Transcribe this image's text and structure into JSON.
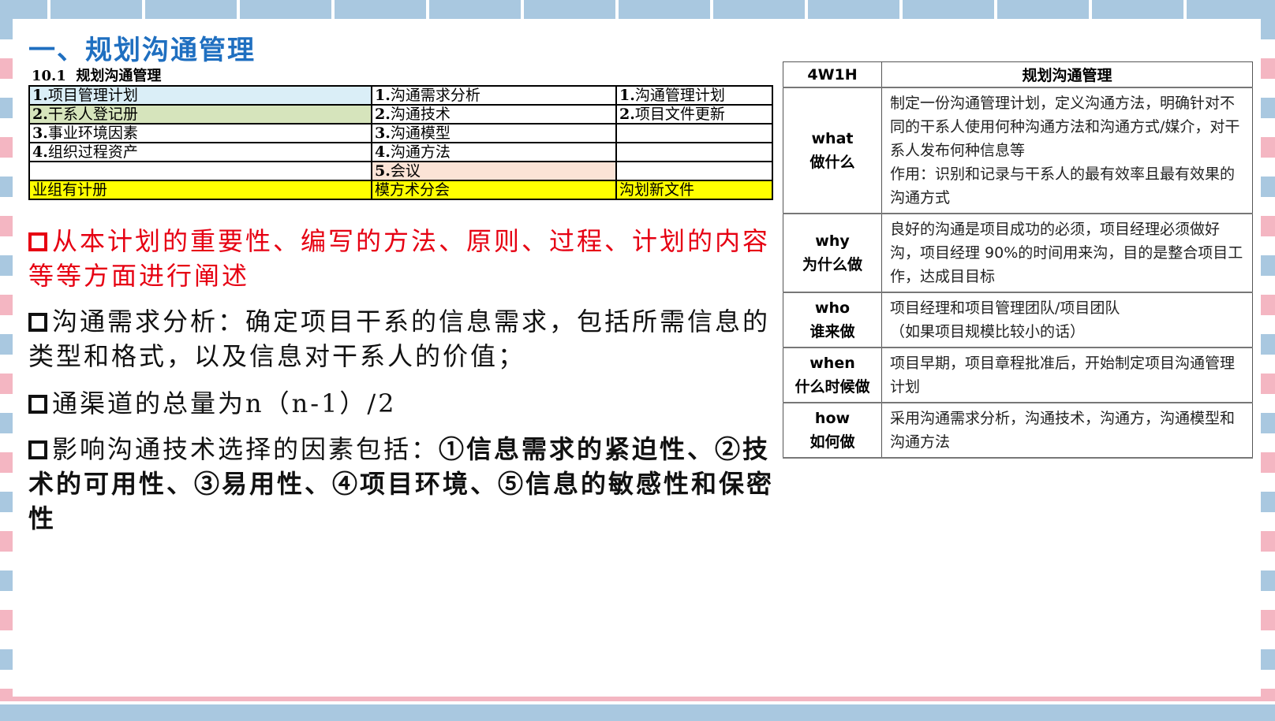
{
  "title": "一、规划沟通管理",
  "itto": {
    "caption_num": "10.1",
    "caption": "规划沟通管理",
    "rows": [
      [
        "1.",
        "项目管理计划",
        "1.",
        "沟通需求分析",
        "1.",
        "沟通管理计划"
      ],
      [
        "2.",
        "干系人登记册",
        "2.",
        "沟通技术",
        "2.",
        "项目文件更新"
      ],
      [
        "3.",
        "事业环境因素",
        "3.",
        "沟通模型",
        "",
        ""
      ],
      [
        "4.",
        "组织过程资产",
        "4.",
        "沟通方法",
        "",
        ""
      ],
      [
        "",
        "",
        "5.",
        "会议",
        "",
        ""
      ],
      [
        "",
        "业组有计册",
        "",
        "模方术分会",
        "",
        "沟划新文件"
      ]
    ],
    "colors": {
      "input1": "#daeef7",
      "input2": "#d6e4bc",
      "meeting": "#fbe3d6",
      "summary": "#ffff00"
    }
  },
  "bullets": {
    "b1": "从本计划的重要性、编写的方法、原则、过程、计划的内容等等方面进行阐述",
    "b2": "沟通需求分析：确定项目干系的信息需求，包括所需信息的类型和格式，以及信息对干系人的价值；",
    "b3": "通渠道的总量为n（n-1）/2",
    "b4_lead": "影响沟通技术选择的因素包括：",
    "b4_rest": "①信息需求的紧迫性、②技术的可用性、③易用性、④项目环境、⑤信息的敏感性和保密性"
  },
  "w4h": {
    "header_left": "4W1H",
    "header_right": "规划沟通管理",
    "rows": [
      {
        "en": "what",
        "zh": "做什么",
        "text1": "制定一份沟通管理计划，定义沟通方法，明确针对不同的干系人使用何种沟通方法和沟通方式/媒介，对干系人发布何种信息等",
        "text2": "作用：识别和记录与干系人的最有效率且最有效果的沟通方式"
      },
      {
        "en": "why",
        "zh": "为什么做",
        "text1": "良好的沟通是项目成功的必须，项目经理必须做好沟，项目经理 90%的时间用来沟，目的是整合项目工作，达成目目标",
        "text2": ""
      },
      {
        "en": "who",
        "zh": "谁来做",
        "text1": "项目经理和项目管理团队/项目团队",
        "text2": "（如果项目规模比较小的话）"
      },
      {
        "en": "when",
        "zh": "什么时候做",
        "text1": "项目早期，项目章程批准后，开始制定项目沟通管理计划",
        "text2": ""
      },
      {
        "en": "how",
        "zh": "如何做",
        "text1": "采用沟通需求分析，沟通技术，沟通方，沟通模型和沟通方法",
        "text2": ""
      }
    ]
  },
  "colors": {
    "title": "#1f6fc0",
    "highlight_red": "#e60012"
  }
}
